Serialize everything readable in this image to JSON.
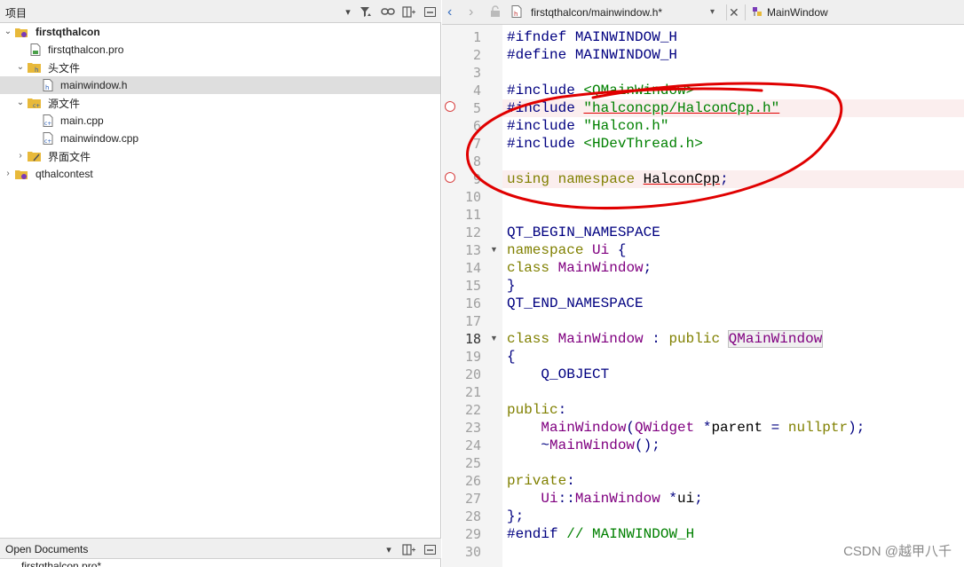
{
  "project_pane": {
    "title": "项目",
    "tree": [
      {
        "label": "firstqthalcon",
        "bold": true,
        "expanded": true,
        "icon": "project-icon"
      },
      {
        "label": "firstqthalcon.pro",
        "icon": "pro-file-icon"
      },
      {
        "label": "头文件",
        "expanded": true,
        "icon": "header-folder-icon"
      },
      {
        "label": "mainwindow.h",
        "icon": "header-file-icon",
        "selected": true
      },
      {
        "label": "源文件",
        "expanded": true,
        "icon": "source-folder-icon"
      },
      {
        "label": "main.cpp",
        "icon": "cpp-file-icon"
      },
      {
        "label": "mainwindow.cpp",
        "icon": "cpp-file-icon"
      },
      {
        "label": "界面文件",
        "expanded": false,
        "icon": "forms-folder-icon"
      },
      {
        "label": "qthalcontest",
        "expanded": false,
        "icon": "project-icon"
      }
    ]
  },
  "open_documents": {
    "title": "Open Documents",
    "first_item": "firstqthalcon.pro*"
  },
  "editor": {
    "file_tab": "firstqthalcon/mainwindow.h*",
    "symbol": "MainWindow",
    "current_line": "18",
    "lines": [
      {
        "n": "1",
        "text": "#ifndef MAINWINDOW_H"
      },
      {
        "n": "2",
        "text": "#define MAINWINDOW_H"
      },
      {
        "n": "3",
        "text": ""
      },
      {
        "n": "4",
        "text": "#include <QMainWindow>"
      },
      {
        "n": "5",
        "text": "#include \"halconcpp/HalconCpp.h\""
      },
      {
        "n": "6",
        "text": "#include \"Halcon.h\""
      },
      {
        "n": "7",
        "text": "#include <HDevThread.h>"
      },
      {
        "n": "8",
        "text": ""
      },
      {
        "n": "9",
        "text": "using namespace HalconCpp;"
      },
      {
        "n": "10",
        "text": ""
      },
      {
        "n": "11",
        "text": ""
      },
      {
        "n": "12",
        "text": "QT_BEGIN_NAMESPACE"
      },
      {
        "n": "13",
        "text": "namespace Ui {"
      },
      {
        "n": "14",
        "text": "class MainWindow;"
      },
      {
        "n": "15",
        "text": "}"
      },
      {
        "n": "16",
        "text": "QT_END_NAMESPACE"
      },
      {
        "n": "17",
        "text": ""
      },
      {
        "n": "18",
        "text": "class MainWindow : public QMainWindow"
      },
      {
        "n": "19",
        "text": "{"
      },
      {
        "n": "20",
        "text": "    Q_OBJECT"
      },
      {
        "n": "21",
        "text": ""
      },
      {
        "n": "22",
        "text": "public:"
      },
      {
        "n": "23",
        "text": "    MainWindow(QWidget *parent = nullptr);"
      },
      {
        "n": "24",
        "text": "    ~MainWindow();"
      },
      {
        "n": "25",
        "text": ""
      },
      {
        "n": "26",
        "text": "private:"
      },
      {
        "n": "27",
        "text": "    Ui::MainWindow *ui;"
      },
      {
        "n": "28",
        "text": "};"
      },
      {
        "n": "29",
        "text": "#endif // MAINWINDOW_H"
      },
      {
        "n": "30",
        "text": ""
      }
    ]
  },
  "watermark": "CSDN @越甲八千",
  "colors": {
    "preprocessor": "#000080",
    "keyword": "#808000",
    "string": "#008000",
    "class": "#800080",
    "annotation_red": "#e00000"
  }
}
